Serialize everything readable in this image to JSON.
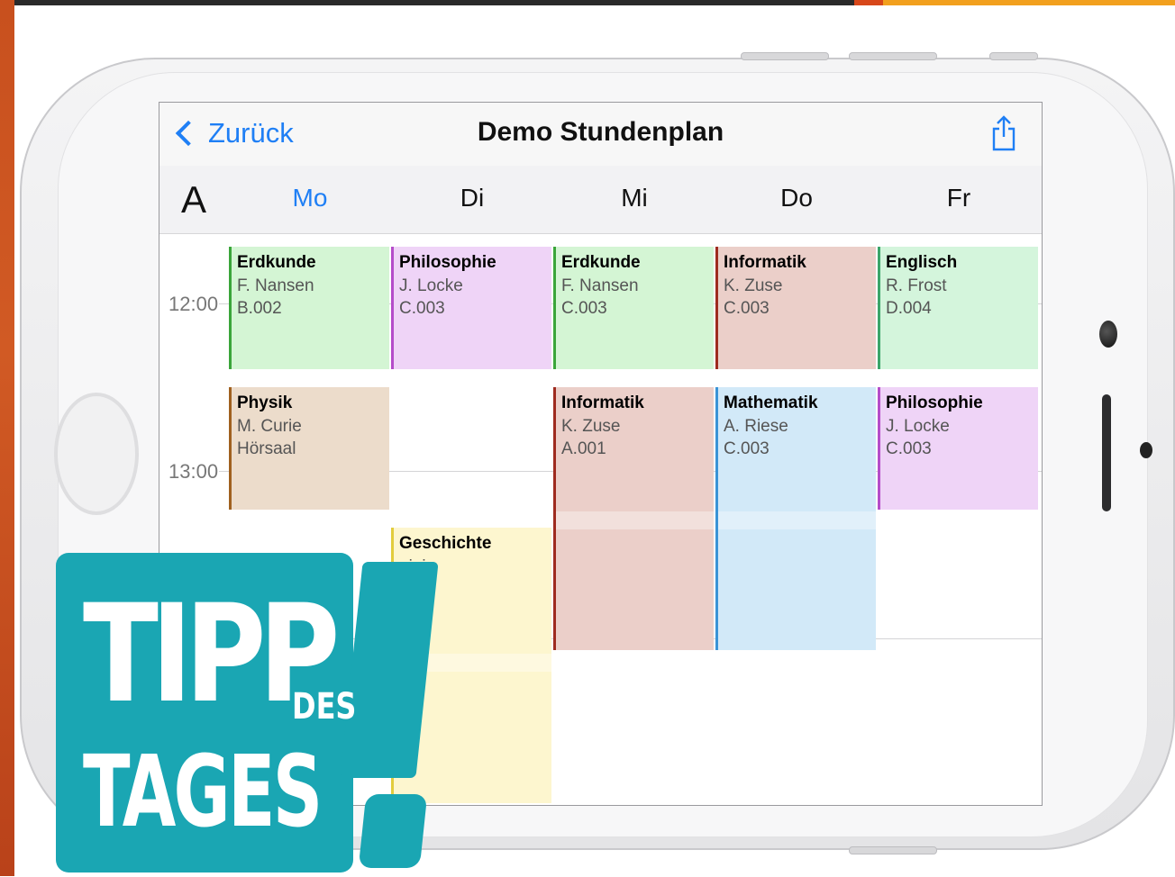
{
  "navbar": {
    "back_label": "Zurück",
    "title": "Demo Stundenplan",
    "share_icon": "share-icon"
  },
  "week": {
    "label": "A",
    "days": [
      "Mo",
      "Di",
      "Mi",
      "Do",
      "Fr"
    ],
    "active_day": "Mo"
  },
  "times": [
    "12:00",
    "13:00"
  ],
  "lessons": [
    {
      "day": "Mo",
      "subject": "Erdkunde",
      "teacher": "F. Nansen",
      "room": "B.002",
      "slot": 1,
      "color": "#d4f5d4",
      "accent": "#3aa53a"
    },
    {
      "day": "Di",
      "subject": "Philosophie",
      "teacher": "J. Locke",
      "room": "C.003",
      "slot": 1,
      "color": "#efd4f7",
      "accent": "#b54cc9"
    },
    {
      "day": "Mi",
      "subject": "Erdkunde",
      "teacher": "F. Nansen",
      "room": "C.003",
      "slot": 1,
      "color": "#d4f5d4",
      "accent": "#3aa53a"
    },
    {
      "day": "Do",
      "subject": "Informatik",
      "teacher": "K. Zuse",
      "room": "C.003",
      "slot": 1,
      "color": "#ebcfc9",
      "accent": "#9e2b1f"
    },
    {
      "day": "Fr",
      "subject": "Englisch",
      "teacher": "R. Frost",
      "room": "D.004",
      "slot": 1,
      "color": "#d4f5dc",
      "accent": "#3aa56a"
    },
    {
      "day": "Mo",
      "subject": "Physik",
      "teacher": "M. Curie",
      "room": "Hörsaal",
      "slot": 2,
      "color": "#ecdccb",
      "accent": "#a0611f"
    },
    {
      "day": "Mi",
      "subject": "Informatik",
      "teacher": "K. Zuse",
      "room": "A.001",
      "slot": 2,
      "color": "#ebcfc9",
      "accent": "#9e2b1f"
    },
    {
      "day": "Do",
      "subject": "Mathematik",
      "teacher": "A. Riese",
      "room": "C.003",
      "slot": 2,
      "color": "#d2e9f8",
      "accent": "#3a93d6"
    },
    {
      "day": "Fr",
      "subject": "Philosophie",
      "teacher": "J. Locke",
      "room": "C.003",
      "slot": 2,
      "color": "#efd4f7",
      "accent": "#b54cc9"
    },
    {
      "day": "Di",
      "subject": "Geschichte",
      "teacher": "nini",
      "room": "",
      "slot": 3,
      "color": "#fdf6cf",
      "accent": "#e2cc3d"
    }
  ],
  "badge": {
    "line1": "TIPP",
    "line2": "DES",
    "line3": "TAGES",
    "color": "#1aa6b3"
  }
}
